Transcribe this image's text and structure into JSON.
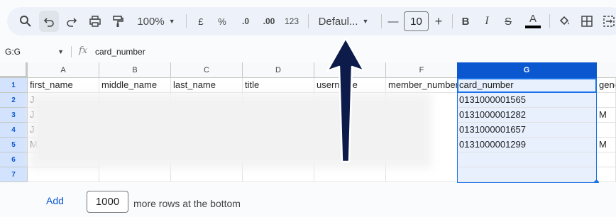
{
  "toolbar": {
    "zoom": "100%",
    "currency": "£",
    "percent": "%",
    "decrease_decimal": ".0",
    "increase_decimal": ".00",
    "number_format": "123",
    "font": "Defaul...",
    "font_size": "10",
    "minus": "—",
    "plus": "+",
    "bold": "B",
    "italic": "I",
    "strike": "S",
    "text_color": "A"
  },
  "formula_bar": {
    "name_box": "G:G",
    "fx": "fx",
    "value": "card_number"
  },
  "grid": {
    "columns": [
      "A",
      "B",
      "C",
      "D",
      "E",
      "F",
      "G"
    ],
    "rows": [
      "1",
      "2",
      "3",
      "4",
      "5",
      "6",
      "7"
    ],
    "headers": [
      "first_name",
      "middle_name",
      "last_name",
      "title",
      "username",
      "member_number",
      "card_number",
      "gender"
    ],
    "col_a_partial": [
      "J",
      "J",
      "J",
      "M"
    ],
    "card_numbers": [
      "0131000001565",
      "0131000001282",
      "0131000001657",
      "0131000001299"
    ],
    "gender": [
      "",
      "M",
      "",
      "M"
    ]
  },
  "footer": {
    "add_label": "Add",
    "rows_value": "1000",
    "rows_text": "more rows at the bottom"
  },
  "colors": {
    "selected_header": "#0b57d0",
    "selection_fill": "#e8f0fe",
    "arrow": "#0d1b4a"
  }
}
